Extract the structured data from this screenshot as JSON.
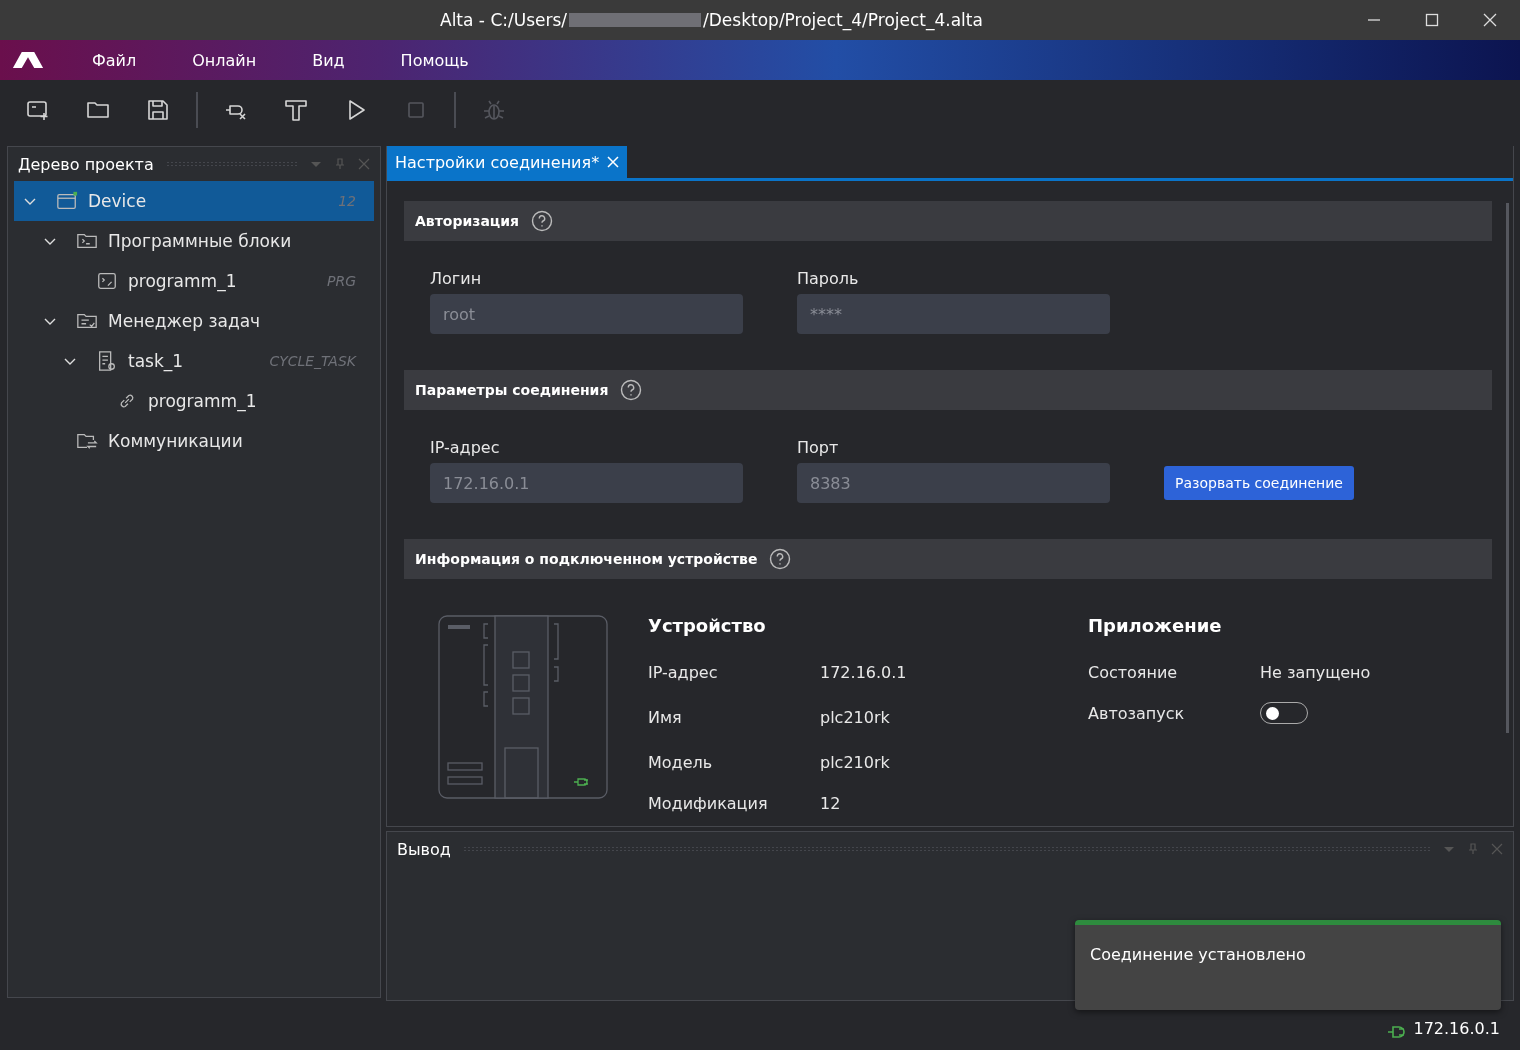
{
  "window": {
    "title_start": "Alta - C:/Users/",
    "title_end": "/Desktop/Project_4/Project_4.alta"
  },
  "menu": [
    "Файл",
    "Онлайн",
    "Вид",
    "Помощь"
  ],
  "toolbar": [
    {
      "kind": "new",
      "disabled": false
    },
    {
      "kind": "open",
      "disabled": false
    },
    {
      "kind": "save",
      "disabled": false
    },
    {
      "kind": "separator"
    },
    {
      "kind": "disconnect",
      "disabled": false
    },
    {
      "kind": "build",
      "disabled": false
    },
    {
      "kind": "run",
      "disabled": false
    },
    {
      "kind": "stop",
      "disabled": true
    },
    {
      "kind": "separator"
    },
    {
      "kind": "debug",
      "disabled": true
    }
  ],
  "project_tree": {
    "title": "Дерево проекта",
    "items": [
      {
        "label": "Device",
        "kind": "device",
        "tag": "12",
        "selected": true,
        "expanded": true,
        "children": [
          {
            "label": "Программные блоки",
            "kind": "code-folder",
            "selected": false,
            "expanded": true,
            "children": [
              {
                "label": "programm_1",
                "kind": "program",
                "tag": "PRG",
                "selected": false
              }
            ]
          },
          {
            "label": "Менеджер задач",
            "kind": "task-folder",
            "selected": false,
            "expanded": true,
            "children": [
              {
                "label": "task_1",
                "kind": "task",
                "tag": "CYCLE_TASK",
                "selected": false,
                "expanded": true,
                "children": [
                  {
                    "label": "programm_1",
                    "kind": "link",
                    "selected": false
                  }
                ]
              }
            ]
          },
          {
            "label": "Коммуникации",
            "kind": "comm-folder",
            "selected": false
          }
        ]
      }
    ]
  },
  "tabs": [
    {
      "label": "Настройки соединения*",
      "selected": true
    }
  ],
  "sections": [
    {
      "title": "Авторизация",
      "fields": [
        {
          "label": "Логин",
          "value": "root",
          "disabled": true
        },
        {
          "label": "Пароль",
          "value": "****",
          "disabled": true
        }
      ]
    },
    {
      "title": "Параметры соединения",
      "fields": [
        {
          "label": "IP-адрес",
          "value": "172.16.0.1",
          "disabled": true
        },
        {
          "label": "Порт",
          "value": "8383",
          "disabled": true
        }
      ],
      "button": "Разорвать соединение"
    },
    {
      "title": "Информация о подключенном устройстве"
    }
  ],
  "device_info": {
    "title": "Устройство",
    "rows": [
      {
        "label": "IP-адрес",
        "value": "172.16.0.1"
      },
      {
        "label": "Имя",
        "value": "plc210rk"
      },
      {
        "label": "Модель",
        "value": "plc210rk"
      },
      {
        "label": "Модификация",
        "value": "12"
      }
    ]
  },
  "app_info": {
    "title": "Приложение",
    "rows": [
      {
        "label": "Состояние",
        "kind": "text",
        "value": "Не запущено"
      },
      {
        "label": "Автозапуск",
        "kind": "toggle",
        "on": false
      }
    ]
  },
  "output": {
    "title": "Вывод"
  },
  "toast": {
    "text": "Соединение установлено",
    "color": "#2e8b3e"
  },
  "status_bar": {
    "address": "172.16.0.1"
  }
}
